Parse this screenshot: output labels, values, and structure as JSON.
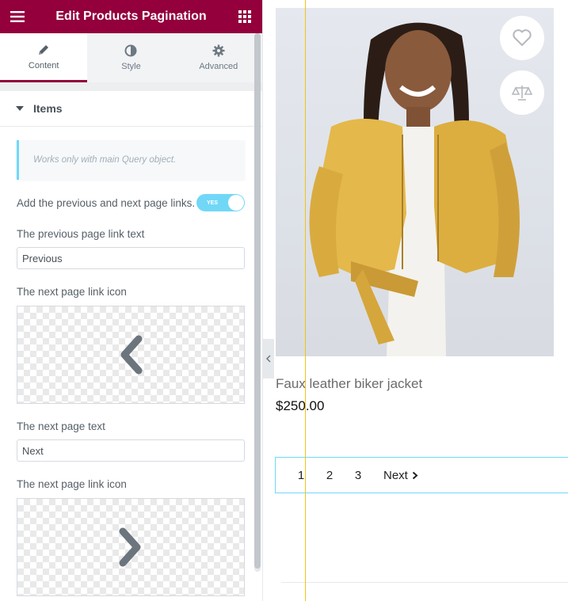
{
  "panel": {
    "title": "Edit Products Pagination",
    "tabs": [
      {
        "label": "Content",
        "icon": "pencil-icon",
        "active": true
      },
      {
        "label": "Style",
        "icon": "half-circle-icon"
      },
      {
        "label": "Advanced",
        "icon": "gear-icon"
      }
    ],
    "section_title": "Items",
    "notice": "Works only with main Query object.",
    "toggle_label": "Add the previous and next page links.",
    "toggle_value": "YES",
    "prev_text_label": "The previous page link text",
    "prev_text_value": "Previous",
    "prev_icon_label": "The next page link icon",
    "next_text_label": "The next page text",
    "next_text_value": "Next",
    "next_icon_label": "The next page link icon"
  },
  "product": {
    "name": "Faux leather biker jacket",
    "price": "$250.00",
    "buttons": [
      "heart-icon",
      "compare-scale-icon"
    ]
  },
  "pagination": {
    "pages": [
      "1",
      "2",
      "3"
    ],
    "next_label": "Next"
  },
  "colors": {
    "brand": "#93003c",
    "accent": "#71d7f7",
    "guide": "#f0c419"
  }
}
